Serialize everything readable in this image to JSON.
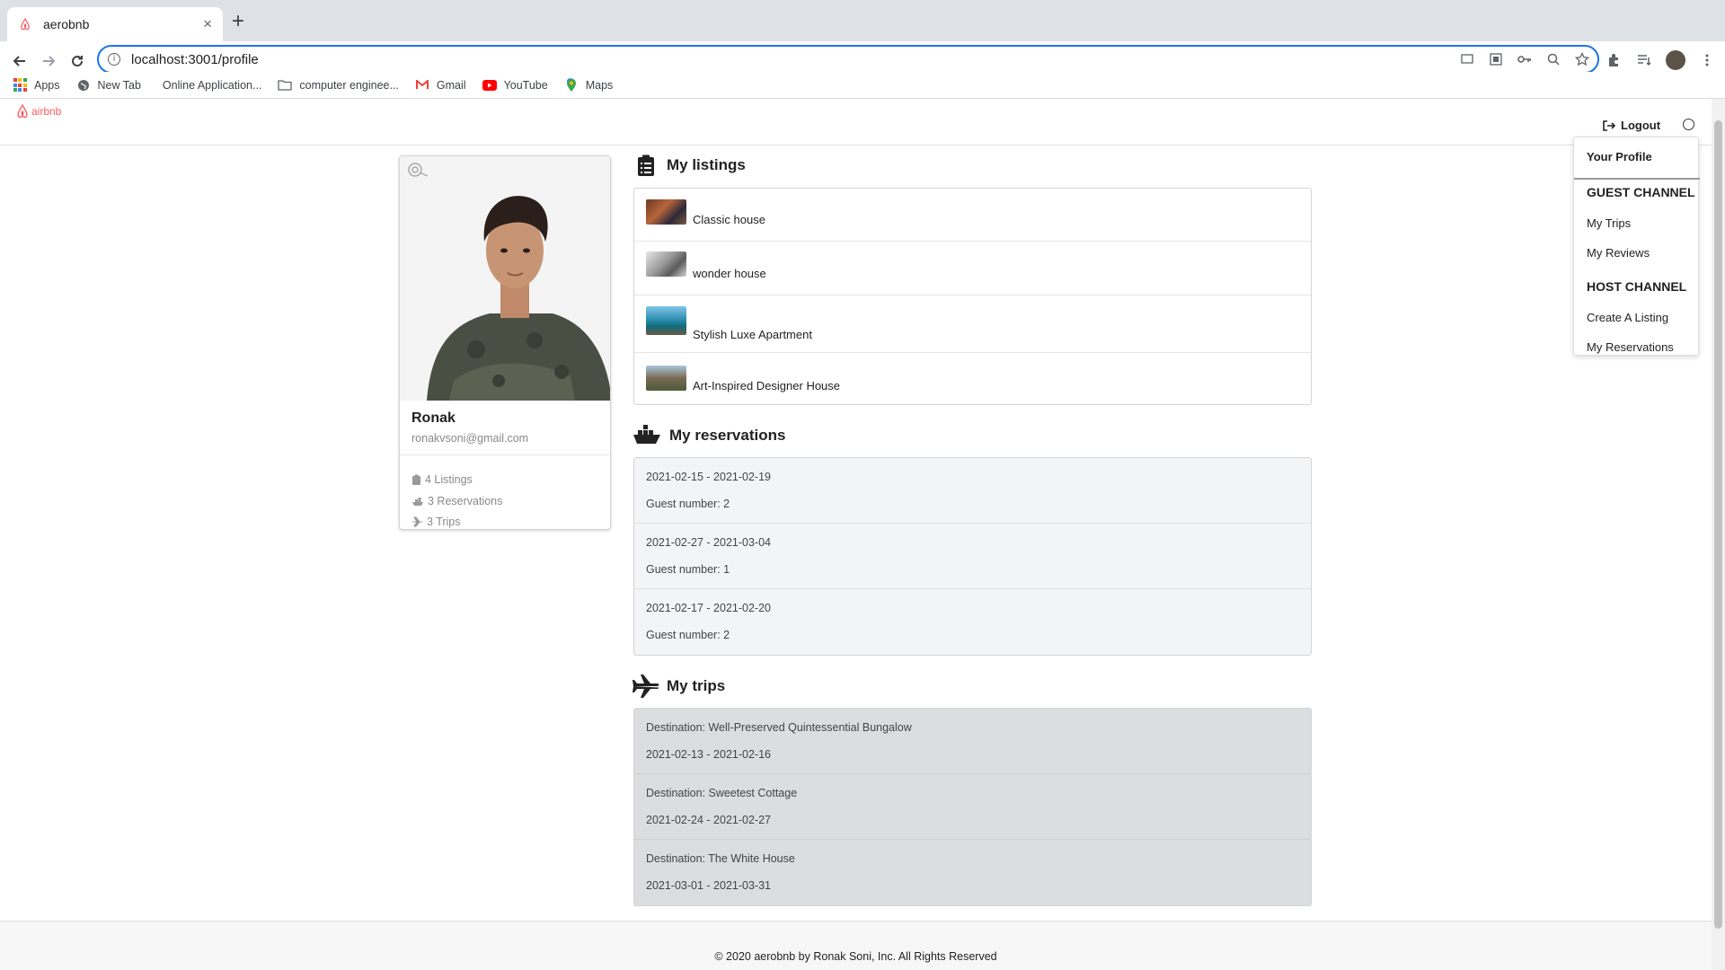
{
  "browser": {
    "tab_title": "aerobnb",
    "url": "localhost:3001/profile",
    "bookmarks": [
      {
        "label": "Apps",
        "icon": "apps-grid-icon"
      },
      {
        "label": "New Tab",
        "icon": "globe-icon"
      },
      {
        "label": "Online Application...",
        "icon": "none"
      },
      {
        "label": "computer enginee...",
        "icon": "folder-icon"
      },
      {
        "label": "Gmail",
        "icon": "gmail-icon"
      },
      {
        "label": "YouTube",
        "icon": "youtube-icon"
      },
      {
        "label": "Maps",
        "icon": "maps-icon"
      }
    ]
  },
  "header": {
    "logo_text": "airbnb",
    "logout_label": "Logout"
  },
  "dropdown": {
    "your_profile": "Your Profile",
    "guest_channel": "GUEST CHANNEL",
    "my_trips": "My Trips",
    "my_reviews": "My Reviews",
    "host_channel": "HOST CHANNEL",
    "create_listing": "Create A Listing",
    "my_reservations": "My Reservations"
  },
  "profile": {
    "name": "Ronak",
    "email": "ronakvsoni@gmail.com",
    "listings_stat": "4 Listings",
    "reservations_stat": "3 Reservations",
    "trips_stat": "3 Trips"
  },
  "listings": {
    "title": "My listings",
    "items": [
      {
        "name": "Classic house"
      },
      {
        "name": "wonder house"
      },
      {
        "name": "Stylish Luxe Apartment"
      },
      {
        "name": "Art-Inspired Designer House"
      }
    ]
  },
  "reservations": {
    "title": "My reservations",
    "items": [
      {
        "dates": "2021-02-15 - 2021-02-19",
        "guests": "Guest number: 2"
      },
      {
        "dates": "2021-02-27 - 2021-03-04",
        "guests": "Guest number: 1"
      },
      {
        "dates": "2021-02-17 - 2021-02-20",
        "guests": "Guest number: 2"
      }
    ]
  },
  "trips": {
    "title": "My trips",
    "items": [
      {
        "destination": "Destination: Well-Preserved Quintessential Bungalow",
        "dates": "2021-02-13 - 2021-02-16"
      },
      {
        "destination": "Destination: Sweetest Cottage",
        "dates": "2021-02-24 - 2021-02-27"
      },
      {
        "destination": "Destination: The White House",
        "dates": "2021-03-01 - 2021-03-31"
      }
    ]
  },
  "footer": {
    "text": "© 2020 aerobnb by Ronak Soni, Inc. All Rights Reserved"
  },
  "colors": {
    "brand": "#ff5a5f",
    "reservation_bg": "#f3f4f5",
    "trip_bg": "#dcdddf"
  }
}
